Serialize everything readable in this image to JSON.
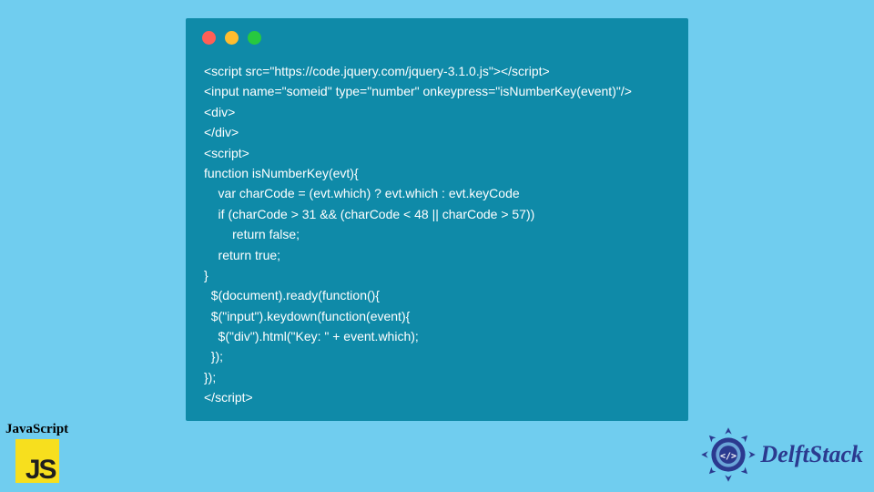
{
  "window": {
    "dots": [
      "red",
      "yellow",
      "green"
    ]
  },
  "code_lines": [
    "<script src=\"https://code.jquery.com/jquery-3.1.0.js\"></script>",
    "<input name=\"someid\" type=\"number\" onkeypress=\"isNumberKey(event)\"/>",
    "<div>",
    "</div>",
    "<script>",
    "function isNumberKey(evt){",
    "    var charCode = (evt.which) ? evt.which : evt.keyCode",
    "    if (charCode > 31 && (charCode < 48 || charCode > 57))",
    "        return false;",
    "    return true;",
    "}",
    "  $(document).ready(function(){",
    "  $(\"input\").keydown(function(event){",
    "    $(\"div\").html(\"Key: \" + event.which);",
    "  });",
    "});",
    "</script>"
  ],
  "js_badge": {
    "label": "JavaScript",
    "logo_text": "JS"
  },
  "delft": {
    "text": "DelftStack",
    "icon_label": "</>"
  }
}
